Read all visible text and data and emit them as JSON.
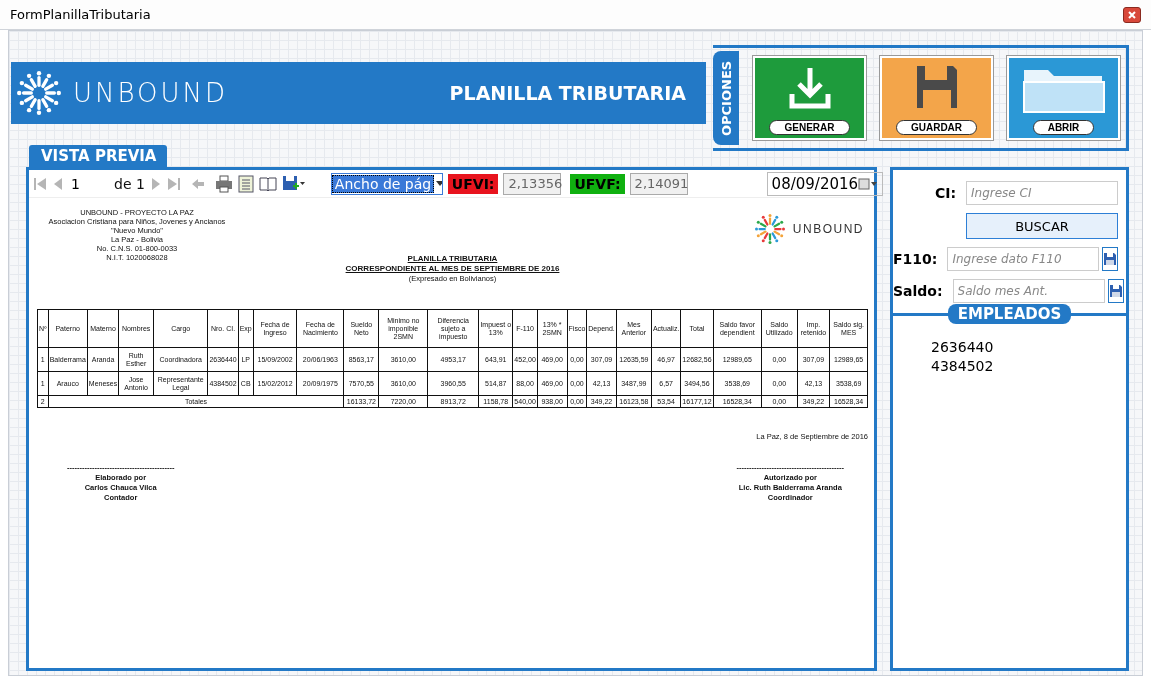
{
  "window": {
    "title": "FormPlanillaTributaria"
  },
  "header": {
    "brand": "UNBOUND",
    "title": "PLANILLA TRIBUTARIA"
  },
  "options": {
    "label": "OPCIONES",
    "buttons": [
      {
        "label": "GENERAR",
        "kind": "download",
        "color": "#1e9b3c"
      },
      {
        "label": "GUARDAR",
        "kind": "save",
        "color": "#f3a54a"
      },
      {
        "label": "ABRIR",
        "kind": "folder",
        "color": "#2b98d6"
      }
    ]
  },
  "preview": {
    "tab": "VISTA PREVIA",
    "toolbar": {
      "page": "1",
      "page_count": "de 1",
      "zoom": "Ancho de pág",
      "ufvi_label": "UFVI:",
      "ufvi_value": "2,13356",
      "ufvf_label": "UFVF:",
      "ufvf_value": "2,14091",
      "date": "08/09/2016"
    },
    "report": {
      "org_lines": [
        "UNBOUND - PROYECTO LA PAZ",
        "Asociacion Cristiana para Niños, Jovenes y Ancianos",
        "\"Nuevo Mundo\"",
        "La Paz - Bolivia",
        "No. C.N.S. 01-800-0033",
        "N.I.T. 1020068028"
      ],
      "logo_text": "UNBOUND",
      "title_lines": [
        "PLANILLA TRIBUTARIA",
        "CORRESPONDIENTE AL MES DE SEPTIEMBRE DE 2016"
      ],
      "subtitle": "(Expresado en Bolivianos)",
      "columns": [
        "Nº",
        "Paterno",
        "Materno",
        "Nombres",
        "Cargo",
        "Nro. CI.",
        "Exp",
        "Fecha de Ingreso",
        "Fecha de Nacimiento",
        "Sueldo Neto",
        "Minimo no imponible 2SMN",
        "Diferencia sujeto a impuesto",
        "Impuest o 13%",
        "F-110",
        "13% * 2SMN",
        "Fisco",
        "Depend.",
        "Mes Anterior",
        "Actualiz.",
        "Total",
        "Saldo favor dependient",
        "Saldo Utilizado",
        "Imp. retenido",
        "Saldo sig. MES"
      ],
      "rows": [
        [
          "1",
          "Balderrama",
          "Aranda",
          "Ruth Esther",
          "Coordinadora",
          "2636440",
          "LP",
          "15/09/2002",
          "20/06/1963",
          "8563,17",
          "3610,00",
          "4953,17",
          "643,91",
          "452,00",
          "469,00",
          "0,00",
          "307,09",
          "12635,59",
          "46,97",
          "12682,56",
          "12989,65",
          "0,00",
          "307,09",
          "12989,65"
        ],
        [
          "1",
          "Arauco",
          "Meneses",
          "Jose Antonio",
          "Representante Legal",
          "4384502",
          "CB",
          "15/02/2012",
          "20/09/1975",
          "7570,55",
          "3610,00",
          "3960,55",
          "514,87",
          "88,00",
          "469,00",
          "0,00",
          "42,13",
          "3487,99",
          "6,57",
          "3494,56",
          "3538,69",
          "0,00",
          "42,13",
          "3538,69"
        ]
      ],
      "totals": {
        "count": "2",
        "label": "Totales",
        "values": [
          "16133,72",
          "7220,00",
          "8913,72",
          "1158,78",
          "540,00",
          "938,00",
          "0,00",
          "349,22",
          "16123,58",
          "53,54",
          "16177,12",
          "16528,34",
          "0,00",
          "349,22",
          "16528,34"
        ]
      },
      "place_date": "La Paz, 8 de Septiembre de 2016",
      "signatures": [
        {
          "line": "-------------------------------------------",
          "role": "Elaborado por",
          "name": "Carlos Chauca Vilca",
          "position": "Contador"
        },
        {
          "line": "-------------------------------------------",
          "role": "Autorizado por",
          "name": "Lic. Ruth Balderrama Aranda",
          "position": "Coordinador"
        }
      ]
    }
  },
  "search": {
    "fields": [
      {
        "label": "CI:",
        "placeholder": "Ingrese CI",
        "kind": "plain"
      },
      {
        "label": "F110:",
        "placeholder": "Ingrese dato F110",
        "kind": "save"
      },
      {
        "label": "Saldo:",
        "placeholder": "Saldo mes Ant.",
        "kind": "save"
      }
    ],
    "button": "BUSCAR"
  },
  "employees": {
    "title": "EMPLEADOS",
    "items": [
      "2636440",
      "4384502"
    ]
  }
}
